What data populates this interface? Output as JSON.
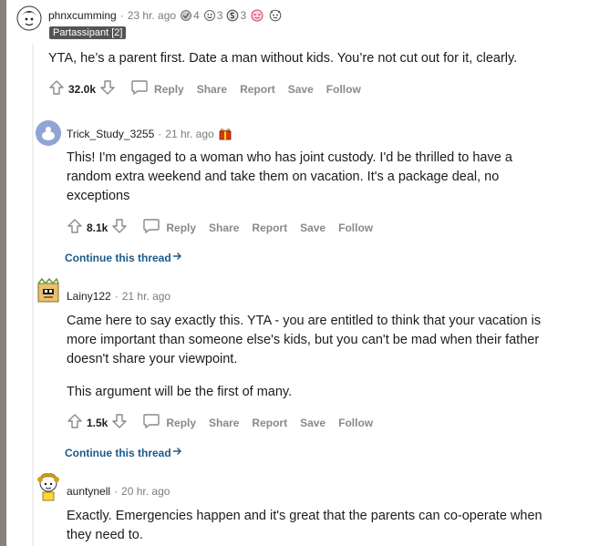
{
  "comments": [
    {
      "author": "phnxcumming",
      "time": "23 hr. ago",
      "flair": "Partassipant [2]",
      "awards": [
        {
          "icon": "helpful-award-icon",
          "count": "4"
        },
        {
          "icon": "wholesome-award-icon",
          "count": "3"
        },
        {
          "icon": "silver-award-icon",
          "count": "3"
        },
        {
          "icon": "heart-eyes-award-icon",
          "count": ""
        },
        {
          "icon": "face-award-icon",
          "count": ""
        }
      ],
      "body": [
        "YTA, he’s a parent first. Date a man without kids. You’re not cut out for it, clearly."
      ],
      "score": "32.0k",
      "actions": {
        "reply": "Reply",
        "share": "Share",
        "report": "Report",
        "save": "Save",
        "follow": "Follow"
      }
    },
    {
      "author": "Trick_Study_3255",
      "time": "21 hr. ago",
      "awards": [
        {
          "icon": "gift-award-icon",
          "count": ""
        }
      ],
      "body": [
        "This! I'm engaged to a woman who has joint custody. I'd be thrilled to have a random extra weekend and take them on vacation. It's a package deal, no exceptions"
      ],
      "score": "8.1k",
      "actions": {
        "reply": "Reply",
        "share": "Share",
        "report": "Report",
        "save": "Save",
        "follow": "Follow"
      },
      "continue": "Continue this thread"
    },
    {
      "author": "Lainy122",
      "time": "21 hr. ago",
      "body": [
        "Came here to say exactly this. YTA - you are entitled to think that your vacation is more important than someone else's kids, but you can't be mad when their father doesn't share your viewpoint.",
        "This argument will be the first of many."
      ],
      "score": "1.5k",
      "actions": {
        "reply": "Reply",
        "share": "Share",
        "report": "Report",
        "save": "Save",
        "follow": "Follow"
      },
      "continue": "Continue this thread"
    },
    {
      "author": "auntynell",
      "time": "20 hr. ago",
      "body": [
        "Exactly. Emergencies happen and it's great that the parents can co-operate when they need to."
      ]
    }
  ],
  "colors": {
    "left_bar": "#8b7f79",
    "link": "#0079d3",
    "flair_bg": "#545452",
    "muted": "#878a8c"
  }
}
